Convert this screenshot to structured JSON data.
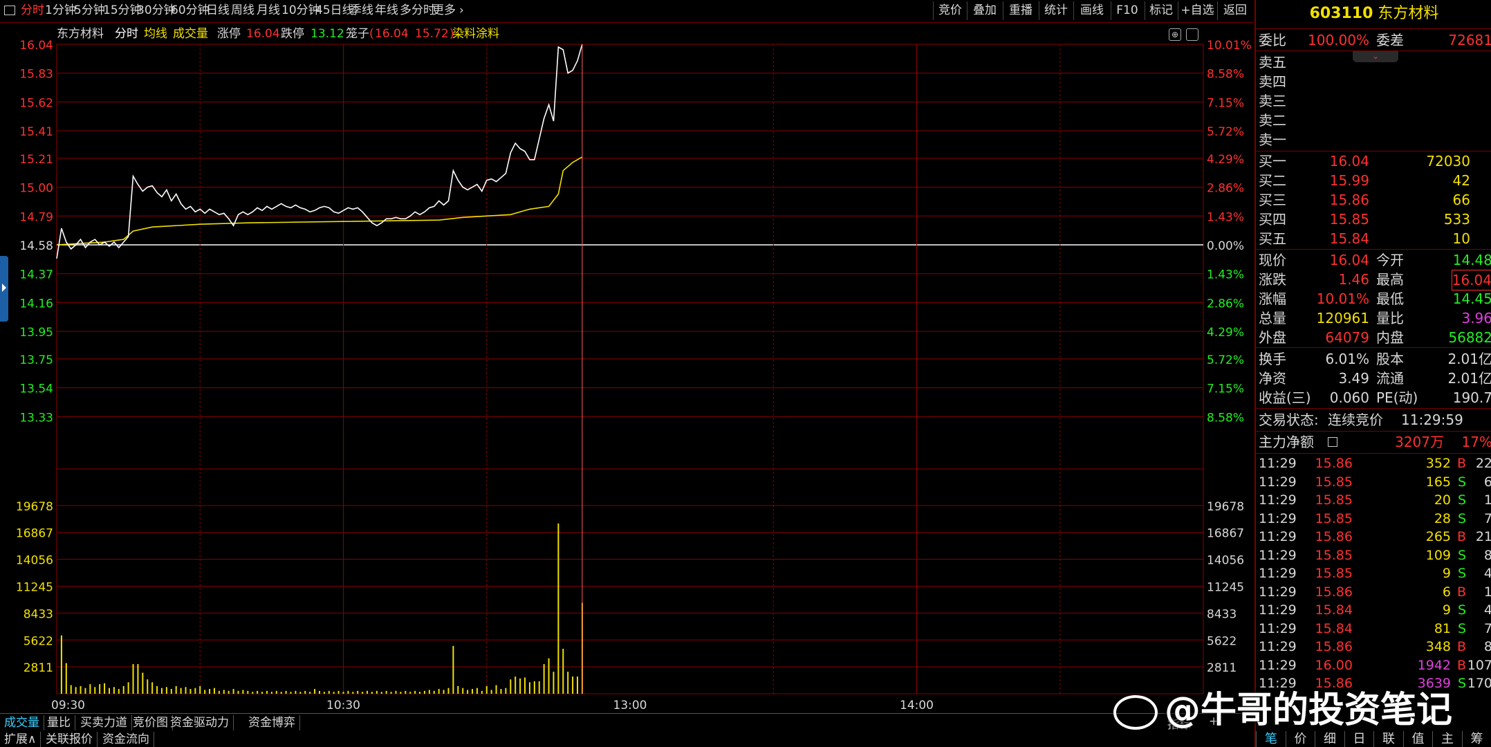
{
  "toolbar": {
    "periods": [
      "分时",
      "1分钟",
      "5分钟",
      "15分钟",
      "30分钟",
      "60分钟",
      "日线",
      "周线",
      "月线",
      "10分钟",
      "45日线",
      "季线",
      "年线",
      "多分时",
      "更多"
    ],
    "more_arrow": "›",
    "tools": [
      "竞价",
      "叠加",
      "重播",
      "统计",
      "画线",
      "F10",
      "标记",
      "+自选",
      "返回"
    ]
  },
  "chart_header": {
    "stock_name": "东方材料",
    "mode": "分时",
    "avg_line": "均线",
    "volume": "成交量",
    "limit_up_label": "涨停",
    "limit_up": "16.04",
    "limit_down_label": "跌停",
    "limit_down": "13.12",
    "cage_label": "笼子",
    "cage_open": "(",
    "cage_hi": "16.04",
    "cage_lo": "15.72",
    "cage_close": ")",
    "sector": "染料涂料"
  },
  "chart_data": {
    "type": "line",
    "title": "",
    "price_axis": {
      "ticks": [
        "16.04",
        "15.83",
        "15.62",
        "15.41",
        "15.21",
        "15.00",
        "14.79",
        "14.58",
        "14.37",
        "14.16",
        "13.95",
        "13.75",
        "13.54",
        "13.33"
      ],
      "ylim": [
        13.12,
        16.04
      ],
      "prev_close": 14.58
    },
    "pct_axis": [
      "10.01%",
      "8.58%",
      "7.15%",
      "5.72%",
      "4.29%",
      "2.86%",
      "1.43%",
      "0.00%",
      "1.43%",
      "2.86%",
      "4.29%",
      "5.72%",
      "7.15%",
      "8.58%"
    ],
    "volume_axis": {
      "ticks": [
        "19678",
        "16867",
        "14056",
        "11245",
        "8433",
        "5622",
        "2811"
      ],
      "ymax": 22489
    },
    "x_ticks": [
      {
        "label": "09:30",
        "minute": 0
      },
      {
        "label": "10:30",
        "minute": 60
      },
      {
        "label": "13:00",
        "minute": 120
      },
      {
        "label": "14:00",
        "minute": 180
      }
    ],
    "x_range_minutes": [
      0,
      240
    ],
    "price_series": {
      "name": "",
      "color": "#ffffff",
      "points": [
        [
          0,
          14.48
        ],
        [
          1,
          14.7
        ],
        [
          2,
          14.6
        ],
        [
          3,
          14.55
        ],
        [
          4,
          14.58
        ],
        [
          5,
          14.62
        ],
        [
          6,
          14.56
        ],
        [
          7,
          14.6
        ],
        [
          8,
          14.62
        ],
        [
          9,
          14.58
        ],
        [
          10,
          14.6
        ],
        [
          11,
          14.57
        ],
        [
          12,
          14.6
        ],
        [
          13,
          14.56
        ],
        [
          14,
          14.6
        ],
        [
          15,
          14.64
        ],
        [
          16,
          15.08
        ],
        [
          17,
          15.02
        ],
        [
          18,
          14.97
        ],
        [
          19,
          15.0
        ],
        [
          20,
          15.01
        ],
        [
          21,
          14.96
        ],
        [
          22,
          14.93
        ],
        [
          23,
          14.98
        ],
        [
          24,
          14.9
        ],
        [
          25,
          14.95
        ],
        [
          26,
          14.88
        ],
        [
          27,
          14.84
        ],
        [
          28,
          14.86
        ],
        [
          29,
          14.82
        ],
        [
          30,
          14.84
        ],
        [
          31,
          14.81
        ],
        [
          32,
          14.84
        ],
        [
          33,
          14.82
        ],
        [
          34,
          14.8
        ],
        [
          35,
          14.81
        ],
        [
          36,
          14.77
        ],
        [
          37,
          14.72
        ],
        [
          38,
          14.8
        ],
        [
          39,
          14.82
        ],
        [
          40,
          14.8
        ],
        [
          41,
          14.82
        ],
        [
          42,
          14.85
        ],
        [
          43,
          14.83
        ],
        [
          44,
          14.86
        ],
        [
          45,
          14.84
        ],
        [
          46,
          14.86
        ],
        [
          47,
          14.88
        ],
        [
          48,
          14.86
        ],
        [
          49,
          14.85
        ],
        [
          50,
          14.87
        ],
        [
          51,
          14.85
        ],
        [
          52,
          14.84
        ],
        [
          53,
          14.82
        ],
        [
          54,
          14.83
        ],
        [
          55,
          14.85
        ],
        [
          56,
          14.86
        ],
        [
          57,
          14.85
        ],
        [
          58,
          14.82
        ],
        [
          59,
          14.81
        ],
        [
          60,
          14.83
        ],
        [
          61,
          14.85
        ],
        [
          62,
          14.84
        ],
        [
          63,
          14.85
        ],
        [
          64,
          14.82
        ],
        [
          65,
          14.78
        ],
        [
          66,
          14.74
        ],
        [
          67,
          14.72
        ],
        [
          68,
          14.74
        ],
        [
          69,
          14.77
        ],
        [
          70,
          14.77
        ],
        [
          71,
          14.78
        ],
        [
          72,
          14.77
        ],
        [
          73,
          14.77
        ],
        [
          74,
          14.79
        ],
        [
          75,
          14.82
        ],
        [
          76,
          14.8
        ],
        [
          77,
          14.82
        ],
        [
          78,
          14.85
        ],
        [
          79,
          14.86
        ],
        [
          80,
          14.9
        ],
        [
          81,
          14.87
        ],
        [
          82,
          14.9
        ],
        [
          83,
          15.12
        ],
        [
          84,
          15.05
        ],
        [
          85,
          15.0
        ],
        [
          86,
          14.98
        ],
        [
          87,
          15.0
        ],
        [
          88,
          15.02
        ],
        [
          89,
          14.97
        ],
        [
          90,
          15.05
        ],
        [
          91,
          15.06
        ],
        [
          92,
          15.04
        ],
        [
          93,
          15.07
        ],
        [
          94,
          15.1
        ],
        [
          95,
          15.25
        ],
        [
          96,
          15.32
        ],
        [
          97,
          15.28
        ],
        [
          98,
          15.26
        ],
        [
          99,
          15.2
        ],
        [
          100,
          15.2
        ],
        [
          101,
          15.35
        ],
        [
          102,
          15.5
        ],
        [
          103,
          15.6
        ],
        [
          104,
          15.48
        ],
        [
          105,
          16.02
        ],
        [
          106,
          16.0
        ],
        [
          107,
          15.83
        ],
        [
          108,
          15.85
        ],
        [
          109,
          15.92
        ],
        [
          110,
          16.04
        ]
      ]
    },
    "avg_series": {
      "name": "",
      "color": "#f2e000",
      "points": [
        [
          0,
          14.58
        ],
        [
          10,
          14.6
        ],
        [
          14,
          14.62
        ],
        [
          16,
          14.68
        ],
        [
          20,
          14.71
        ],
        [
          30,
          14.73
        ],
        [
          40,
          14.74
        ],
        [
          60,
          14.75
        ],
        [
          80,
          14.76
        ],
        [
          85,
          14.78
        ],
        [
          95,
          14.8
        ],
        [
          99,
          14.84
        ],
        [
          103,
          14.86
        ],
        [
          105,
          14.95
        ],
        [
          106,
          15.12
        ],
        [
          108,
          15.18
        ],
        [
          110,
          15.22
        ]
      ]
    },
    "volume_bars": [
      [
        1,
        6100
      ],
      [
        2,
        3200
      ],
      [
        3,
        900
      ],
      [
        4,
        700
      ],
      [
        5,
        800
      ],
      [
        6,
        600
      ],
      [
        7,
        1000
      ],
      [
        8,
        700
      ],
      [
        9,
        1000
      ],
      [
        10,
        1100
      ],
      [
        11,
        600
      ],
      [
        12,
        700
      ],
      [
        13,
        500
      ],
      [
        14,
        800
      ],
      [
        15,
        1200
      ],
      [
        16,
        3100
      ],
      [
        17,
        3100
      ],
      [
        18,
        2200
      ],
      [
        19,
        1500
      ],
      [
        20,
        1200
      ],
      [
        21,
        800
      ],
      [
        22,
        600
      ],
      [
        23,
        700
      ],
      [
        24,
        500
      ],
      [
        25,
        800
      ],
      [
        26,
        600
      ],
      [
        27,
        700
      ],
      [
        28,
        500
      ],
      [
        29,
        600
      ],
      [
        30,
        800
      ],
      [
        31,
        400
      ],
      [
        32,
        500
      ],
      [
        33,
        600
      ],
      [
        34,
        300
      ],
      [
        35,
        400
      ],
      [
        36,
        300
      ],
      [
        37,
        500
      ],
      [
        38,
        300
      ],
      [
        39,
        400
      ],
      [
        40,
        300
      ],
      [
        41,
        200
      ],
      [
        42,
        300
      ],
      [
        43,
        200
      ],
      [
        44,
        300
      ],
      [
        45,
        200
      ],
      [
        46,
        300
      ],
      [
        47,
        200
      ],
      [
        48,
        300
      ],
      [
        49,
        200
      ],
      [
        50,
        300
      ],
      [
        51,
        200
      ],
      [
        52,
        300
      ],
      [
        53,
        200
      ],
      [
        54,
        500
      ],
      [
        55,
        300
      ],
      [
        56,
        200
      ],
      [
        57,
        300
      ],
      [
        58,
        200
      ],
      [
        59,
        300
      ],
      [
        60,
        200
      ],
      [
        61,
        300
      ],
      [
        62,
        200
      ],
      [
        63,
        300
      ],
      [
        64,
        200
      ],
      [
        65,
        300
      ],
      [
        66,
        200
      ],
      [
        67,
        300
      ],
      [
        68,
        200
      ],
      [
        69,
        300
      ],
      [
        70,
        200
      ],
      [
        71,
        300
      ],
      [
        72,
        200
      ],
      [
        73,
        300
      ],
      [
        74,
        200
      ],
      [
        75,
        300
      ],
      [
        76,
        200
      ],
      [
        77,
        300
      ],
      [
        78,
        400
      ],
      [
        79,
        300
      ],
      [
        80,
        500
      ],
      [
        81,
        400
      ],
      [
        82,
        600
      ],
      [
        83,
        5000
      ],
      [
        84,
        800
      ],
      [
        85,
        600
      ],
      [
        86,
        400
      ],
      [
        87,
        500
      ],
      [
        88,
        600
      ],
      [
        89,
        300
      ],
      [
        90,
        800
      ],
      [
        91,
        400
      ],
      [
        92,
        900
      ],
      [
        93,
        500
      ],
      [
        94,
        600
      ],
      [
        95,
        1500
      ],
      [
        96,
        1800
      ],
      [
        97,
        1600
      ],
      [
        98,
        1700
      ],
      [
        99,
        1200
      ],
      [
        100,
        1300
      ],
      [
        101,
        1300
      ],
      [
        102,
        3100
      ],
      [
        103,
        3700
      ],
      [
        104,
        2300
      ],
      [
        105,
        17800
      ],
      [
        106,
        4700
      ],
      [
        107,
        2300
      ],
      [
        108,
        1800
      ],
      [
        109,
        1800
      ],
      [
        110,
        9500
      ]
    ]
  },
  "quote": {
    "code": "603110",
    "name": "东方材料",
    "weibi_label": "委比",
    "weibi": "100.00%",
    "weicha_label": "委差",
    "weicha": "72681",
    "sell_labels": [
      "卖五",
      "卖四",
      "卖三",
      "卖二",
      "卖一"
    ],
    "buy": [
      {
        "label": "买一",
        "price": "16.04",
        "vol": "72030"
      },
      {
        "label": "买二",
        "price": "15.99",
        "vol": "42"
      },
      {
        "label": "买三",
        "price": "15.86",
        "vol": "66"
      },
      {
        "label": "买四",
        "price": "15.85",
        "vol": "533"
      },
      {
        "label": "买五",
        "price": "15.84",
        "vol": "10"
      }
    ],
    "stats": [
      {
        "l1": "现价",
        "v1": "16.04",
        "c1": "#ff3030",
        "l2": "今开",
        "v2": "14.48",
        "c2": "#22ee22"
      },
      {
        "l1": "涨跌",
        "v1": "1.46",
        "c1": "#ff3030",
        "l2": "最高",
        "v2": "16.04",
        "c2": "#ff3030"
      },
      {
        "l1": "涨幅",
        "v1": "10.01%",
        "c1": "#ff3030",
        "l2": "最低",
        "v2": "14.45",
        "c2": "#22ee22"
      },
      {
        "l1": "总量",
        "v1": "120961",
        "c1": "#f2e000",
        "l2": "量比",
        "v2": "3.96",
        "c2": "#e040e0"
      },
      {
        "l1": "外盘",
        "v1": "64079",
        "c1": "#ff3030",
        "l2": "内盘",
        "v2": "56882",
        "c2": "#22ee22"
      }
    ],
    "stats2": [
      {
        "l1": "换手",
        "v1": "6.01%",
        "l2": "股本",
        "v2": "2.01亿"
      },
      {
        "l1": "净资",
        "v1": "3.49",
        "l2": "流通",
        "v2": "2.01亿"
      },
      {
        "l1": "收益(三)",
        "v1": "0.060",
        "l2": "PE(动)",
        "v2": "190.7"
      }
    ],
    "status_label": "交易状态:",
    "status": "连续竞价",
    "status_time": "11:29:59",
    "main_net_label": "主力净额",
    "main_net": "3207万",
    "main_net_pct": "17%"
  },
  "trades": [
    {
      "t": "11:29",
      "p": "15.86",
      "v": "352",
      "vc": "#f2e000",
      "bs": "B",
      "n": "22"
    },
    {
      "t": "11:29",
      "p": "15.85",
      "v": "165",
      "vc": "#f2e000",
      "bs": "S",
      "n": "6"
    },
    {
      "t": "11:29",
      "p": "15.85",
      "v": "20",
      "vc": "#f2e000",
      "bs": "S",
      "n": "1"
    },
    {
      "t": "11:29",
      "p": "15.85",
      "v": "28",
      "vc": "#f2e000",
      "bs": "S",
      "n": "7"
    },
    {
      "t": "11:29",
      "p": "15.86",
      "v": "265",
      "vc": "#f2e000",
      "bs": "B",
      "n": "21"
    },
    {
      "t": "11:29",
      "p": "15.85",
      "v": "109",
      "vc": "#f2e000",
      "bs": "S",
      "n": "8"
    },
    {
      "t": "11:29",
      "p": "15.85",
      "v": "9",
      "vc": "#f2e000",
      "bs": "S",
      "n": "4"
    },
    {
      "t": "11:29",
      "p": "15.86",
      "v": "6",
      "vc": "#f2e000",
      "bs": "B",
      "n": "1"
    },
    {
      "t": "11:29",
      "p": "15.84",
      "v": "9",
      "vc": "#f2e000",
      "bs": "S",
      "n": "4"
    },
    {
      "t": "11:29",
      "p": "15.84",
      "v": "81",
      "vc": "#f2e000",
      "bs": "S",
      "n": "7"
    },
    {
      "t": "11:29",
      "p": "15.86",
      "v": "348",
      "vc": "#f2e000",
      "bs": "B",
      "n": "8"
    },
    {
      "t": "11:29",
      "p": "16.00",
      "v": "1942",
      "vc": "#e040e0",
      "bs": "B",
      "n": "107"
    },
    {
      "t": "11:29",
      "p": "15.86",
      "v": "3639",
      "vc": "#e040e0",
      "bs": "S",
      "n": "170"
    }
  ],
  "bottom_tabs": [
    "成交量",
    "量比",
    "买卖力道",
    "竞价图",
    "资金驱动力",
    "资金博弈"
  ],
  "bottom_tabs2": [
    "扩展∧",
    "关联报价",
    "资金流向"
  ],
  "bottom_right": [
    "指标",
    "+"
  ],
  "right_tabs": [
    "笔",
    "价",
    "细",
    "日",
    "联",
    "值",
    "主",
    "筹"
  ],
  "watermark": "@牛哥的投资笔记",
  "colors": {
    "up": "#ff3030",
    "down": "#22ee22",
    "grid": "#8b0000",
    "avg": "#f2e000",
    "price": "#ffffff",
    "accent": "#38d0ff"
  }
}
